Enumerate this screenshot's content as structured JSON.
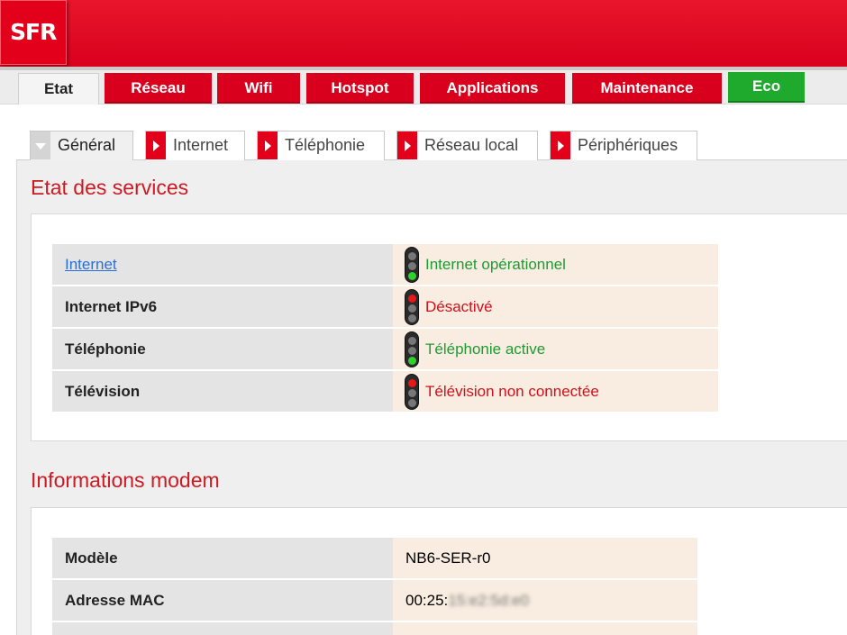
{
  "header": {
    "logo": "SFR"
  },
  "main_nav": [
    {
      "label": "Etat",
      "active": true
    },
    {
      "label": "Réseau"
    },
    {
      "label": "Wifi"
    },
    {
      "label": "Hotspot"
    },
    {
      "label": "Applications"
    },
    {
      "label": "Maintenance"
    },
    {
      "label": "Eco"
    }
  ],
  "sub_tabs": [
    {
      "label": "Général",
      "active": true
    },
    {
      "label": "Internet"
    },
    {
      "label": "Téléphonie"
    },
    {
      "label": "Réseau local"
    },
    {
      "label": "Périphériques"
    }
  ],
  "services": {
    "title": "Etat des services",
    "rows": [
      {
        "label": "Internet",
        "status": "Internet opérationnel",
        "state": "green"
      },
      {
        "label": "Internet IPv6",
        "status": "Désactivé",
        "state": "red"
      },
      {
        "label": "Téléphonie",
        "status": "Téléphonie active",
        "state": "green"
      },
      {
        "label": "Télévision",
        "status": "Télévision non connectée",
        "state": "red"
      }
    ]
  },
  "modem": {
    "title": "Informations modem",
    "rows": [
      {
        "label": "Modèle",
        "value": "NB6-SER-r0"
      },
      {
        "label": "Adresse MAC",
        "value": "00:25:",
        "value_blurred": "15:e2:5d:e0"
      }
    ]
  },
  "colors": {
    "brand_red": "#e2001a",
    "eco_green": "#1faa2e",
    "ok_green": "#1f9a35",
    "error_red": "#d0101c"
  }
}
